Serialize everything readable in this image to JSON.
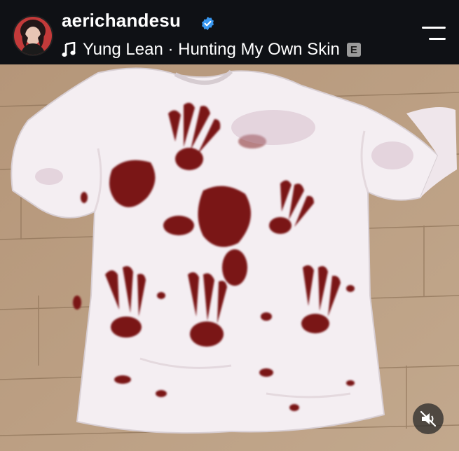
{
  "header": {
    "username": "aerichandesu",
    "verified": true,
    "music": {
      "icon": "music-note-icon",
      "text": "Yung Lean · Hunting My Own Skin",
      "explicit_badge": "E"
    },
    "menu_icon": "hamburger-menu-icon"
  },
  "media": {
    "description_icon": "photo",
    "mute_icon": "speaker-muted-icon"
  },
  "colors": {
    "header_bg": "#0f1115",
    "verified_blue": "#3897f0",
    "floor": "#b89c80",
    "shirt": "#f4eef2",
    "stain": "#7a1216"
  }
}
